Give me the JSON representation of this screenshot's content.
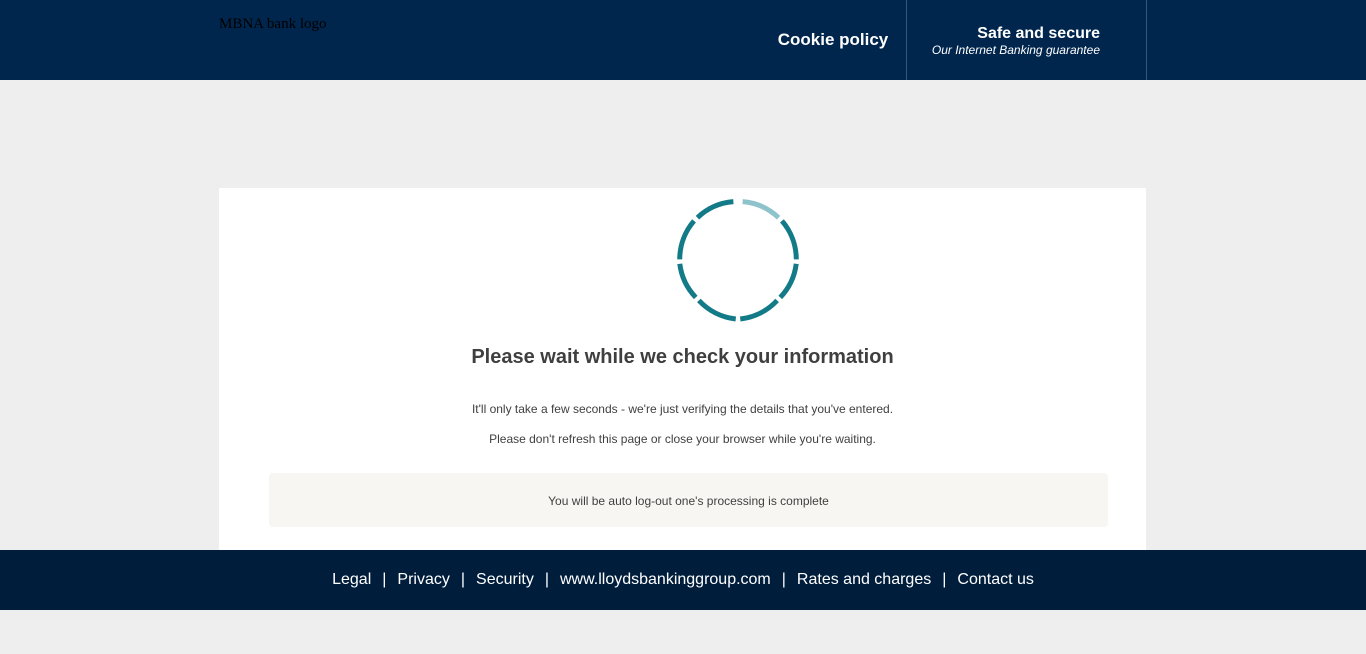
{
  "colors": {
    "header_bg": "#00264d",
    "footer_bg": "#001e3c",
    "page_bg": "#eeeeee",
    "card_bg": "#ffffff",
    "spinner_teal": "#137a88",
    "spinner_light": "#8ec3cb",
    "notice_bg": "#f8f6f3",
    "text_dark": "#3f3f3f"
  },
  "header": {
    "logo_alt": "MBNA bank logo",
    "cookie_label": "Cookie policy",
    "safe_title": "Safe and secure",
    "safe_subtitle": "Our Internet Banking guarantee"
  },
  "main": {
    "spinner_icon": "loading-spinner-icon",
    "title": "Please wait while we check your information",
    "text1": "It'll only take a few seconds - we're just verifying the details that you've entered.",
    "text2": "Please don't refresh this page or close your browser while you're waiting.",
    "notice": "You will be auto log-out one's processing is complete"
  },
  "footer": {
    "links": [
      "Legal",
      "Privacy",
      "Security",
      "www.lloydsbankinggroup.com",
      "Rates and charges",
      "Contact us"
    ],
    "separator": "|"
  }
}
